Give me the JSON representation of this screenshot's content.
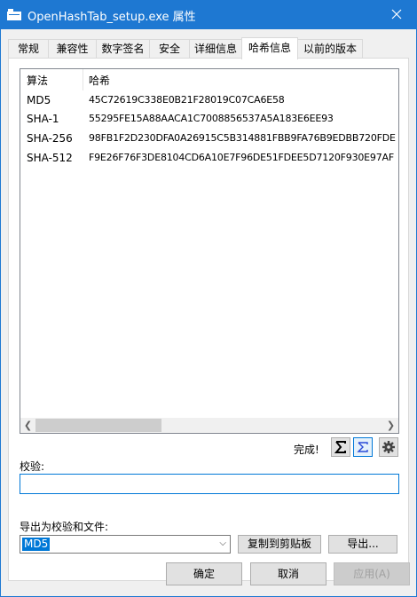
{
  "window": {
    "title": "OpenHashTab_setup.exe 属性",
    "accent": "#1e78d2"
  },
  "tabs": [
    {
      "label": "常规"
    },
    {
      "label": "兼容性"
    },
    {
      "label": "数字签名"
    },
    {
      "label": "安全"
    },
    {
      "label": "详细信息"
    },
    {
      "label": "哈希信息",
      "active": true
    },
    {
      "label": "以前的版本"
    }
  ],
  "hash_list": {
    "columns": [
      "算法",
      "哈希"
    ],
    "rows": [
      {
        "algorithm": "MD5",
        "hash": "45C72619C338E0B21F28019C07CA6E58"
      },
      {
        "algorithm": "SHA-1",
        "hash": "55295FE15A88AACA1C7008856537A5A183E6EE93"
      },
      {
        "algorithm": "SHA-256",
        "hash": "98FB1F2D230DFA0A26915C5B314881FBB9FA76B9EDBB720FDE"
      },
      {
        "algorithm": "SHA-512",
        "hash": "F9E26F76F3DE8104CD6A10E7F96DE51FDEE5D7120F930E97AF"
      }
    ]
  },
  "status": {
    "text": "完成!",
    "icons": [
      "sum-icon",
      "sum-outline-icon",
      "gear-icon"
    ]
  },
  "verify": {
    "label": "校验:",
    "value": ""
  },
  "export": {
    "label": "导出为校验和文件:",
    "selected_algorithm": "MD5",
    "copy_button": "复制到剪贴板",
    "export_button": "导出..."
  },
  "footer": {
    "ok": "确定",
    "cancel": "取消",
    "apply": "应用(A)"
  }
}
